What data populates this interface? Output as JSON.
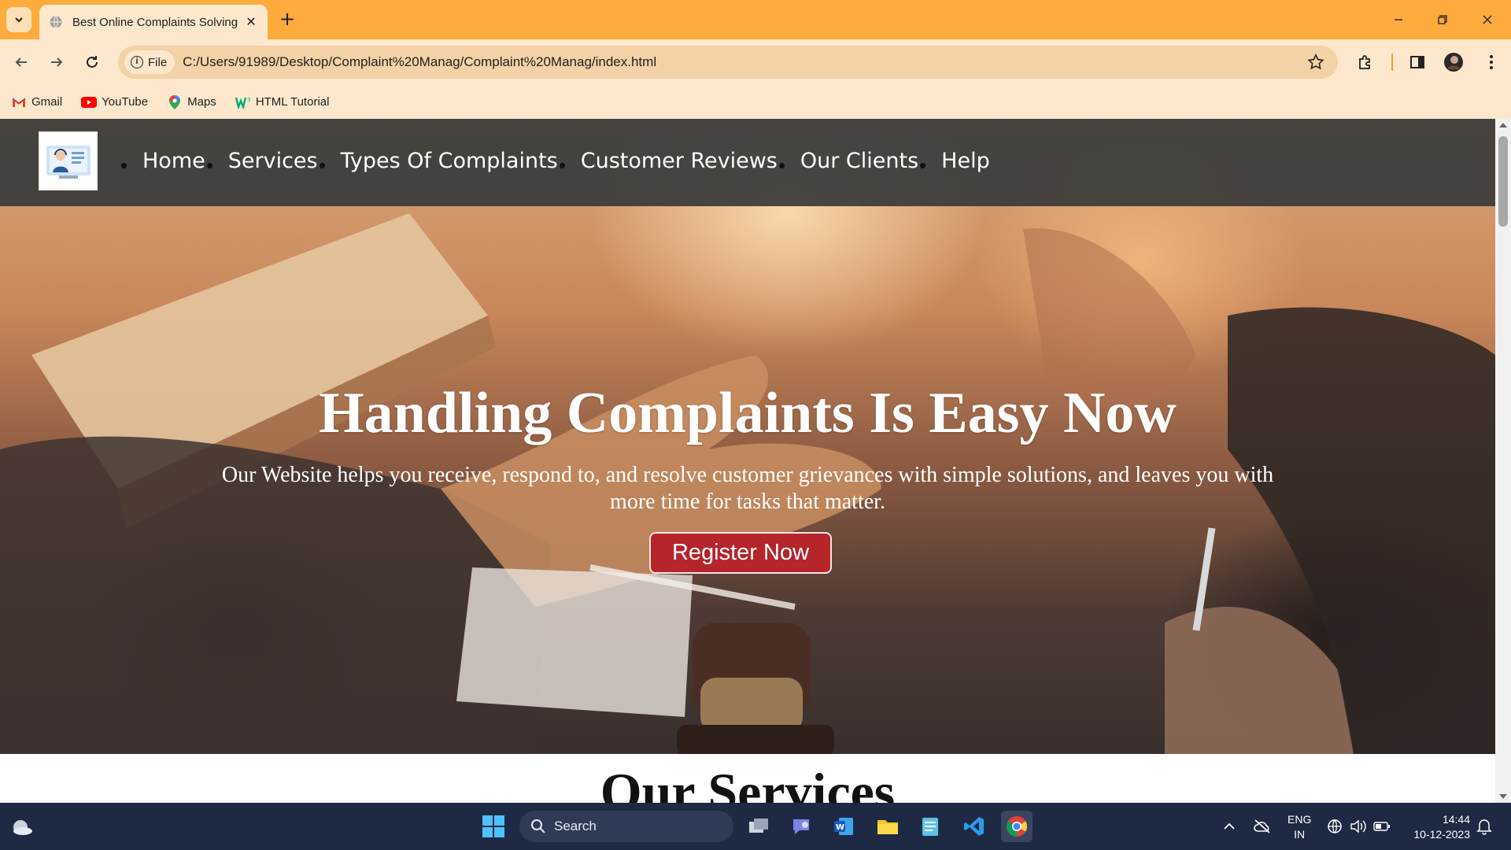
{
  "browser": {
    "tab_title": "Best Online Complaints Solving",
    "file_chip": "File",
    "url": "C:/Users/91989/Desktop/Complaint%20Manag/Complaint%20Manag/index.html",
    "bookmarks": [
      {
        "label": "Gmail",
        "icon": "gmail-icon"
      },
      {
        "label": "YouTube",
        "icon": "youtube-icon"
      },
      {
        "label": "Maps",
        "icon": "maps-icon"
      },
      {
        "label": "HTML Tutorial",
        "icon": "w3schools-icon"
      }
    ],
    "colors": {
      "frame": "#fdab3d",
      "toolbar": "#fde8cd",
      "omnibox": "#f2d2a6"
    }
  },
  "site": {
    "nav": [
      "Home",
      "Services",
      "Types Of Complaints",
      "Customer Reviews",
      "Our Clients",
      "Help"
    ],
    "hero_title": "Handling Complaints Is Easy Now",
    "hero_sub": "Our Website helps you receive, respond to, and resolve customer grievances with simple solutions, and leaves you with more time for tasks that matter.",
    "register_label": "Register Now",
    "services_heading": "Our Services",
    "colors": {
      "navbar": "#3a3a3a",
      "button": "#b5252a"
    }
  },
  "taskbar": {
    "search_label": "Search",
    "lang_line1": "ENG",
    "lang_line2": "IN",
    "time": "14:44",
    "date": "10-12-2023"
  }
}
